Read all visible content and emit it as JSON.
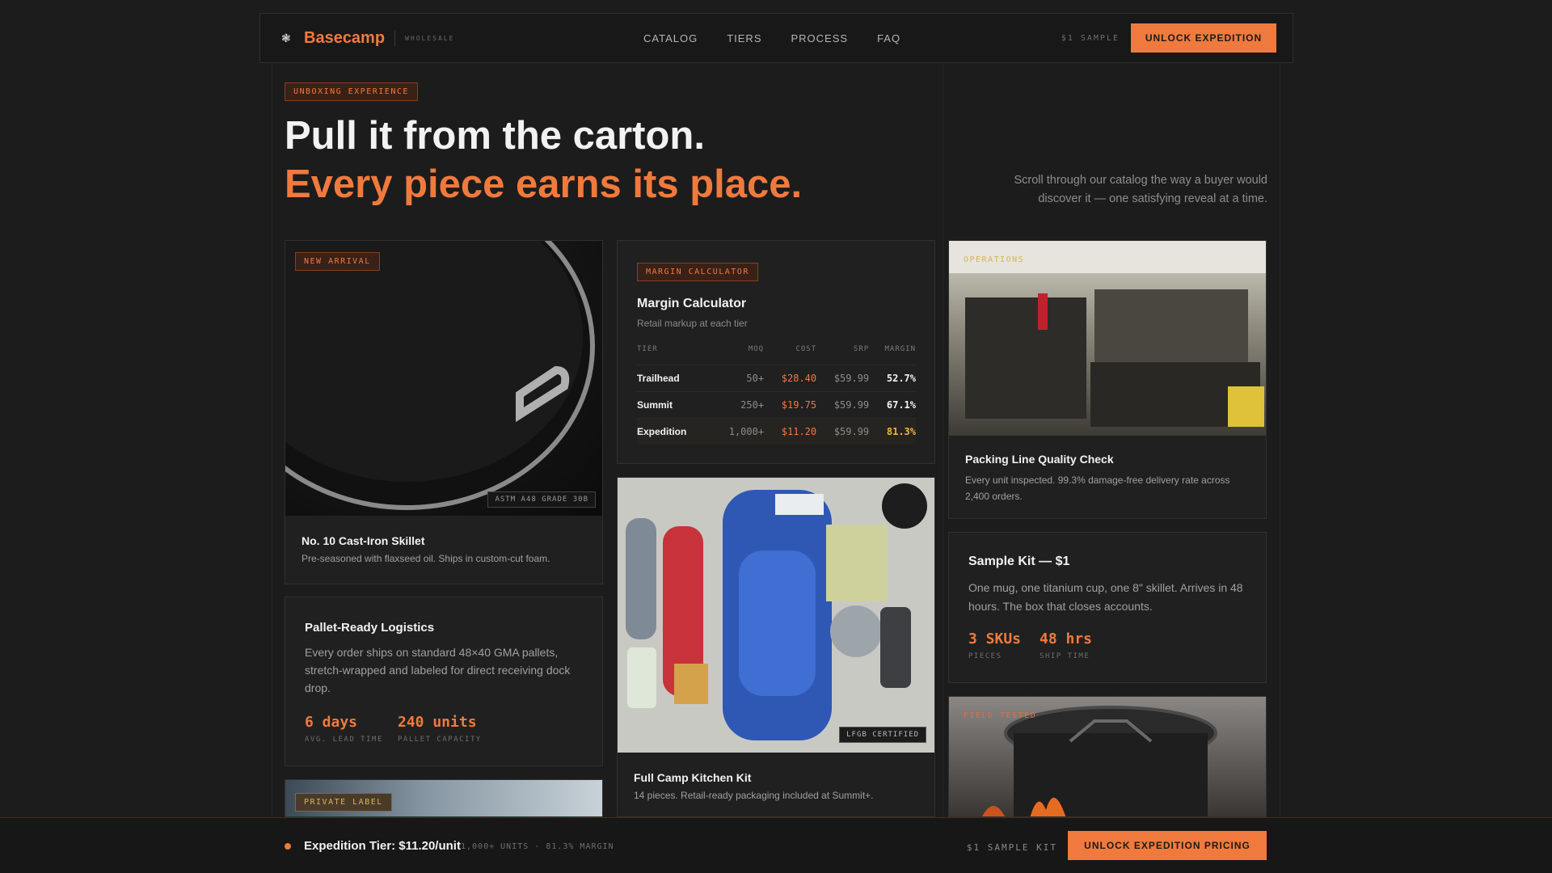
{
  "header": {
    "brand": "Basecamp",
    "brand_sub": "WHOLESALE",
    "nav": [
      "CATALOG",
      "TIERS",
      "PROCESS",
      "FAQ"
    ],
    "sample_label": "$1 SAMPLE",
    "cta": "UNLOCK EXPEDITION"
  },
  "hero": {
    "tag": "UNBOXING EXPERIENCE",
    "title_line1": "Pull it from the carton.",
    "title_line2": "Every piece earns its place.",
    "description": "Scroll through our catalog the way a buyer would discover it — one satisfying reveal at a time."
  },
  "cards": {
    "skillet": {
      "tag": "NEW ARRIVAL",
      "badge": "ASTM A48 GRADE 30B",
      "title": "No. 10 Cast-Iron Skillet",
      "desc": "Pre-seasoned with flaxseed oil. Ships in custom-cut foam."
    },
    "logistics": {
      "title": "Pallet-Ready Logistics",
      "desc": "Every order ships on standard 48×40 GMA pallets, stretch-wrapped and labeled for direct receiving dock drop.",
      "stats": [
        {
          "value": "6 days",
          "label": "AVG. LEAD TIME"
        },
        {
          "value": "240 units",
          "label": "PALLET CAPACITY"
        }
      ]
    },
    "private_label": {
      "tag": "PRIVATE LABEL"
    },
    "margin": {
      "tag": "MARGIN CALCULATOR",
      "title": "Margin Calculator",
      "subtitle": "Retail markup at each tier",
      "headers": [
        "TIER",
        "MOQ",
        "COST",
        "SRP",
        "MARGIN"
      ],
      "rows": [
        {
          "tier": "Trailhead",
          "moq": "50+",
          "cost": "$28.40",
          "srp": "$59.99",
          "margin": "52.7%"
        },
        {
          "tier": "Summit",
          "moq": "250+",
          "cost": "$19.75",
          "srp": "$59.99",
          "margin": "67.1%"
        },
        {
          "tier": "Expedition",
          "moq": "1,000+",
          "cost": "$11.20",
          "srp": "$59.99",
          "margin": "81.3%"
        }
      ]
    },
    "kitchen": {
      "badge": "LFGB CERTIFIED",
      "title": "Full Camp Kitchen Kit",
      "desc": "14 pieces. Retail-ready packaging included at Summit+."
    },
    "operations": {
      "tag": "OPERATIONS",
      "title": "Packing Line Quality Check",
      "desc": "Every unit inspected. 99.3% damage-free delivery rate across 2,400 orders."
    },
    "sample_kit": {
      "title": "Sample Kit — $1",
      "desc": "One mug, one titanium cup, one 8\" skillet. Arrives in 48 hours. The box that closes accounts.",
      "stats": [
        {
          "value": "3 SKUs",
          "label": "PIECES"
        },
        {
          "value": "48 hrs",
          "label": "SHIP TIME"
        }
      ]
    },
    "field_tested": {
      "tag": "FIELD TESTED"
    }
  },
  "bottom_bar": {
    "title": "Expedition Tier: $11.20/unit",
    "meta": "1,000+ UNITS · 81.3% MARGIN",
    "sample": "$1 SAMPLE KIT",
    "cta": "UNLOCK EXPEDITION PRICING"
  },
  "colors": {
    "accent": "#f07a3d",
    "background": "#1c1c1c",
    "highlight": "#f2b544"
  }
}
